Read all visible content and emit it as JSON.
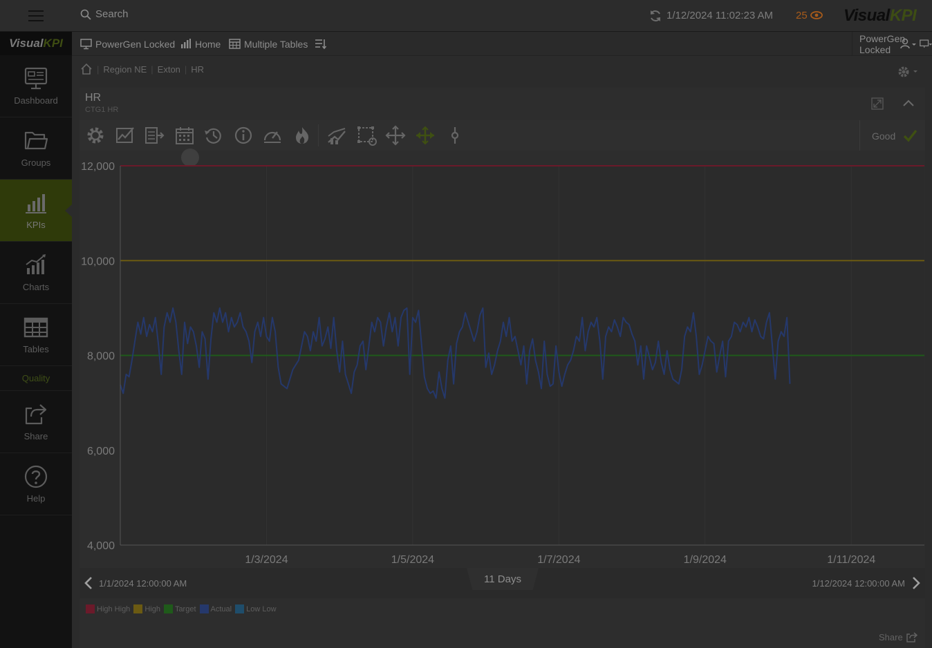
{
  "topbar": {
    "search_placeholder": "Search",
    "timestamp": "1/12/2024 11:02:23 AM",
    "alert_count": "25",
    "brand_visual": "Visual",
    "brand_kpi": "KPI"
  },
  "sidebar": {
    "logo_visual": "Visual",
    "logo_kpi": "KPI",
    "items": [
      {
        "label": "Dashboard",
        "icon": "dashboard-icon"
      },
      {
        "label": "Groups",
        "icon": "folder-icon"
      },
      {
        "label": "KPIs",
        "icon": "kpi-bars-icon",
        "active": true
      },
      {
        "label": "Charts",
        "icon": "chart-icon"
      },
      {
        "label": "Tables",
        "icon": "table-icon"
      }
    ],
    "section": "Quality",
    "items2": [
      {
        "label": "Share",
        "icon": "share-icon"
      },
      {
        "label": "Help",
        "icon": "help-icon"
      }
    ]
  },
  "navbar": {
    "links": [
      "PowerGen Locked",
      "Home",
      "Multiple Tables"
    ],
    "right_label": "PowerGen Locked"
  },
  "breadcrumb": [
    "Region NE",
    "Exton",
    "HR"
  ],
  "panel": {
    "title": "HR",
    "subtitle": "CTG1 HR",
    "status": "Good"
  },
  "colors": {
    "high_high": "#6b1a2a",
    "high": "#6b5a12",
    "target": "#1f5a1a",
    "actual": "#25386b",
    "low_low": "#1f4d6b",
    "accent": "#3f5012"
  },
  "timenav": {
    "start": "1/1/2024 12:00:00 AM",
    "end": "1/12/2024 12:00:00 AM",
    "duration": "11 Days"
  },
  "legend": [
    {
      "label": "High High",
      "color": "#6b1a2a"
    },
    {
      "label": "High",
      "color": "#6b5a12"
    },
    {
      "label": "Target",
      "color": "#1f5a1a"
    },
    {
      "label": "Actual",
      "color": "#25386b"
    },
    {
      "label": "Low Low",
      "color": "#1f4d6b"
    }
  ],
  "share_label": "Share",
  "chart_data": {
    "type": "line",
    "ylim": [
      4000,
      12000
    ],
    "yticks": [
      "12,000",
      "10,000",
      "8,000",
      "6,000",
      "4,000"
    ],
    "xlim": [
      0,
      11
    ],
    "xticks": [
      {
        "x": 2,
        "label": "1/3/2024"
      },
      {
        "x": 4,
        "label": "1/5/2024"
      },
      {
        "x": 6,
        "label": "1/7/2024"
      },
      {
        "x": 8,
        "label": "1/9/2024"
      },
      {
        "x": 10,
        "label": "1/11/2024"
      }
    ],
    "thresholds": {
      "high_high": 12000,
      "high": 10000,
      "target": 8000
    },
    "series": [
      {
        "name": "Actual",
        "x_step_days": 0.04,
        "values": [
          7380,
          7200,
          7600,
          7550,
          7900,
          8300,
          8700,
          8450,
          8800,
          8400,
          8650,
          8500,
          8800,
          8250,
          7600,
          8600,
          8900,
          8700,
          9000,
          8700,
          8100,
          7600,
          8700,
          8250,
          8600,
          8500,
          8200,
          7750,
          8500,
          8350,
          7500,
          8350,
          8900,
          8700,
          9000,
          8700,
          8900,
          8500,
          8800,
          8600,
          8700,
          8900,
          8600,
          8500,
          8300,
          7850,
          8500,
          8700,
          8400,
          8800,
          8400,
          8300,
          8800,
          8500,
          7750,
          7400,
          7350,
          7300,
          7500,
          7700,
          7800,
          7900,
          8200,
          8500,
          8400,
          8100,
          8500,
          8300,
          8800,
          8200,
          8350,
          8600,
          8150,
          8800,
          8100,
          7650,
          8300,
          7600,
          7400,
          7200,
          7650,
          7800,
          8200,
          8300,
          7700,
          8200,
          8700,
          8500,
          8800,
          8700,
          8200,
          8600,
          8900,
          8500,
          8800,
          8200,
          8800,
          8950,
          9000,
          7600,
          8800,
          8700,
          8950,
          8250,
          7550,
          7300,
          7200,
          7250,
          7100,
          7650,
          7300,
          7100,
          7900,
          8200,
          7400,
          8250,
          8500,
          8600,
          8900,
          8700,
          8500,
          8300,
          8500,
          8850,
          9000,
          7750,
          8050,
          7600,
          7800,
          8100,
          8300,
          8700,
          8400,
          8800,
          8300,
          8400,
          8100,
          7800,
          8200,
          7400,
          8100,
          8350,
          7900,
          7650,
          7300,
          8300,
          7600,
          7350,
          7400,
          8200,
          7650,
          7350,
          7600,
          7800,
          7900,
          8100,
          8400,
          8300,
          8800,
          8100,
          8500,
          8700,
          8600,
          8800,
          8300,
          7500,
          8400,
          8600,
          8500,
          8750,
          8600,
          8400,
          8800,
          8700,
          8650,
          8450,
          8300,
          7800,
          8200,
          7500,
          8200,
          7950,
          7700,
          7850,
          8300,
          7850,
          7600,
          8100,
          7700,
          7500,
          7450,
          7400,
          7700,
          8400,
          8600,
          8500,
          8900,
          8400,
          7600,
          7800,
          8100,
          8400,
          8300,
          8250,
          7650,
          8000,
          8300,
          7550,
          8300,
          8400,
          8700,
          8650,
          8500,
          8700,
          8600,
          8800,
          8500,
          8750,
          8600,
          8400,
          8350,
          8700,
          8900,
          8200,
          7500,
          8300,
          8500,
          8400,
          8800,
          7400
        ]
      }
    ]
  }
}
